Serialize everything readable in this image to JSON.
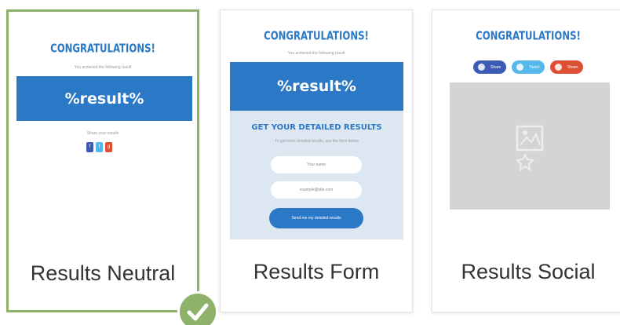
{
  "congrats_title": "CONGRATULATIONS!",
  "result_placeholder": "%result%",
  "cards": [
    {
      "label": "Results Neutral",
      "selected": true,
      "subtext": "You achieved the following result",
      "share_text": "Share your results",
      "social_squares": [
        "f",
        "t",
        "g"
      ]
    },
    {
      "label": "Results Form",
      "selected": false,
      "subtext": "You achieved the following result",
      "form_heading": "GET YOUR DETAILED RESULTS",
      "form_subtext": "To get more detailed results, use the form below",
      "input_name_placeholder": "Your name",
      "input_email_placeholder": "example@site.com",
      "submit_label": "Send me my detailed results"
    },
    {
      "label": "Results Social",
      "selected": false,
      "share_buttons": [
        {
          "label": "Share",
          "color": "#3b5bb5"
        },
        {
          "label": "Tweet",
          "color": "#55b7ea"
        },
        {
          "label": "Share",
          "color": "#dd5035"
        }
      ]
    }
  ],
  "colors": {
    "accent_blue": "#2b78c6",
    "selected_green": "#8fb26b",
    "panel_blue": "#dde7f1",
    "media_gray": "#d4d4d4"
  },
  "icons": {
    "selected": "check-icon",
    "image_placeholder": "image-placeholder-icon"
  }
}
